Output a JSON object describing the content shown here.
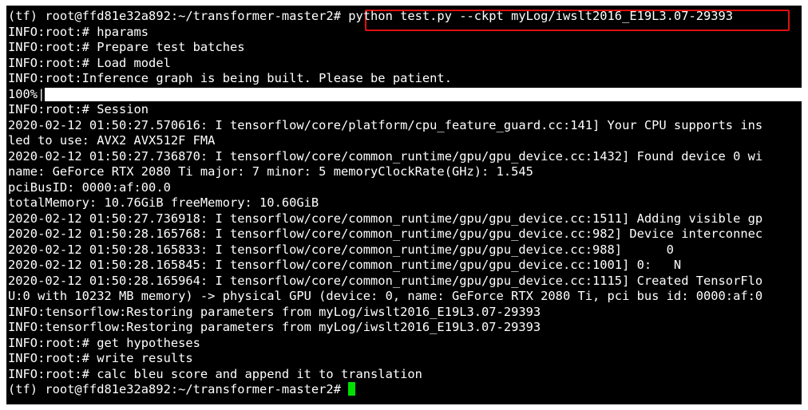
{
  "terminal": {
    "lines": [
      {
        "prompt": "(tf) root@ffd81e32a892:~/transformer-master2# ",
        "command": "python test.py --ckpt myLog/iwslt2016_E19L3.07-29393"
      },
      {
        "text": "INFO:root:# hparams"
      },
      {
        "text": "INFO:root:# Prepare test batches"
      },
      {
        "text": "INFO:root:# Load model"
      },
      {
        "text": "INFO:root:Inference graph is being built. Please be patient."
      },
      {
        "progress_label": "100%|",
        "progress_value": 100
      },
      {
        "text": "INFO:root:# Session"
      },
      {
        "text": "2020-02-12 01:50:27.570616: I tensorflow/core/platform/cpu_feature_guard.cc:141] Your CPU supports ins"
      },
      {
        "text": "led to use: AVX2 AVX512F FMA"
      },
      {
        "text": "2020-02-12 01:50:27.736870: I tensorflow/core/common_runtime/gpu/gpu_device.cc:1432] Found device 0 wi"
      },
      {
        "text": "name: GeForce RTX 2080 Ti major: 7 minor: 5 memoryClockRate(GHz): 1.545"
      },
      {
        "text": "pciBusID: 0000:af:00.0"
      },
      {
        "text": "totalMemory: 10.76GiB freeMemory: 10.60GiB"
      },
      {
        "text": "2020-02-12 01:50:27.736918: I tensorflow/core/common_runtime/gpu/gpu_device.cc:1511] Adding visible gp"
      },
      {
        "text": "2020-02-12 01:50:28.165768: I tensorflow/core/common_runtime/gpu/gpu_device.cc:982] Device interconnec"
      },
      {
        "text": "2020-02-12 01:50:28.165833: I tensorflow/core/common_runtime/gpu/gpu_device.cc:988]      0"
      },
      {
        "text": "2020-02-12 01:50:28.165845: I tensorflow/core/common_runtime/gpu/gpu_device.cc:1001] 0:   N"
      },
      {
        "text": "2020-02-12 01:50:28.165964: I tensorflow/core/common_runtime/gpu/gpu_device.cc:1115] Created TensorFlo"
      },
      {
        "text": "U:0 with 10232 MB memory) -> physical GPU (device: 0, name: GeForce RTX 2080 Ti, pci bus id: 0000:af:0"
      },
      {
        "text": "INFO:tensorflow:Restoring parameters from myLog/iwslt2016_E19L3.07-29393"
      },
      {
        "text": "INFO:tensorflow:Restoring parameters from myLog/iwslt2016_E19L3.07-29393"
      },
      {
        "text": "INFO:root:# get hypotheses"
      },
      {
        "text": "INFO:root:# write results"
      },
      {
        "text": "INFO:root:# calc bleu score and append it to translation"
      },
      {
        "prompt": "(tf) root@ffd81e32a892:~/transformer-master2# ",
        "cursor": true
      }
    ],
    "colors": {
      "background": "#000000",
      "foreground": "#ffffff",
      "highlight_box": "#e01010",
      "cursor": "#00e000"
    }
  }
}
